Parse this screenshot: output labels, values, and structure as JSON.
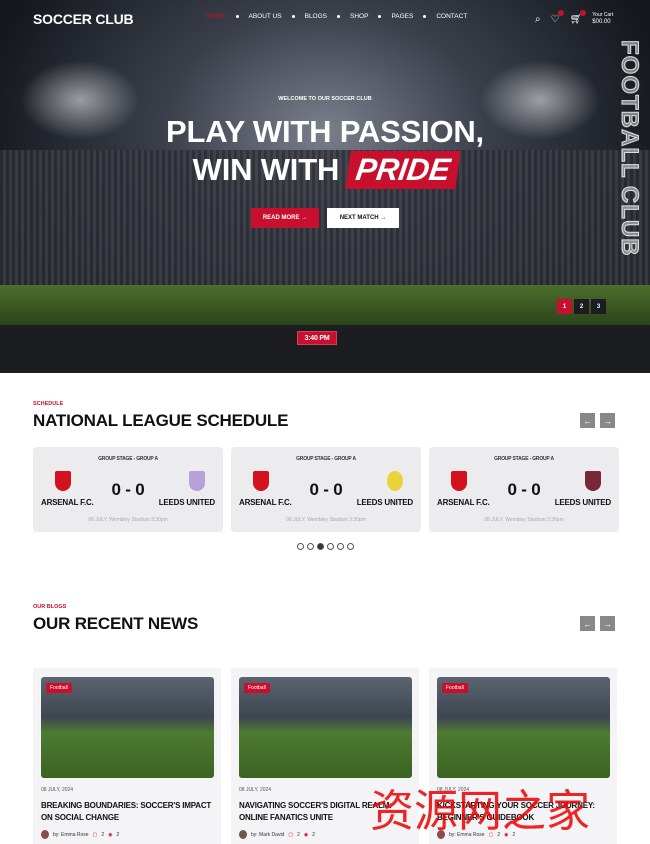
{
  "header": {
    "logo": "SOCCER CLUB",
    "menu": [
      "HOME",
      "ABOUT US",
      "BLOGS",
      "SHOP",
      "PAGES",
      "CONTACT"
    ],
    "cart_label": "Your Cart",
    "cart_total": "$00.00",
    "accent": "#c8102e"
  },
  "hero": {
    "welcome": "WELCOME TO OUR SOCCER CLUB",
    "line1": "PLAY WITH PASSION,",
    "line2a": "WIN WITH",
    "line2b": "PRIDE",
    "read_more": "READ MORE",
    "next_match": "NEXT MATCH",
    "vertical": "FOOTBALL CLUB",
    "pages": [
      "1",
      "2",
      "3"
    ],
    "active_page": 1,
    "time": "3:40 PM"
  },
  "schedule": {
    "tag": "SCHEDULE",
    "title": "NATIONAL LEAGUE SCHEDULE",
    "matches": [
      {
        "stage": "GROUP STAGE - GROUP A",
        "home": "ARSENAL F.C.",
        "away": "LEEDS UNITED",
        "score": "0 - 0",
        "info": "08 JULY, Wembley Stadium 3:30pm"
      },
      {
        "stage": "GROUP STAGE - GROUP A",
        "home": "ARSENAL F.C.",
        "away": "LEEDS UNITED",
        "score": "0 - 0",
        "info": "08 JULY, Wembley Stadium 3:30pm"
      },
      {
        "stage": "GROUP STAGE - GROUP A",
        "home": "ARSENAL F.C.",
        "away": "LEEDS UNITED",
        "score": "0 - 0",
        "info": "08 JULY, Wembley Stadium 3:30pm"
      }
    ],
    "dots": 6,
    "active_dot": 3
  },
  "news": {
    "tag": "OUR BLOGS",
    "title": "OUR RECENT NEWS",
    "posts": [
      {
        "category": "Football",
        "date": "08 JULY, 2024",
        "title": "BREAKING BOUNDARIES: SOCCER'S IMPACT ON SOCIAL CHANGE",
        "author": "by: Emma Rose",
        "comments": "2",
        "views": "2"
      },
      {
        "category": "Football",
        "date": "08 JULY, 2024",
        "title": "NAVIGATING SOCCER'S DIGITAL REALM: ONLINE FANATICS UNITE",
        "author": "by: Mark David",
        "comments": "2",
        "views": "2"
      },
      {
        "category": "Football",
        "date": "08 JULY, 2024",
        "title": "KICKSTARTING YOUR SOCCER JOURNEY: BEGINNER'S GUIDEBOOK",
        "author": "by: Emma Rose",
        "comments": "2",
        "views": "2"
      }
    ]
  },
  "watermark": "资源网之家"
}
